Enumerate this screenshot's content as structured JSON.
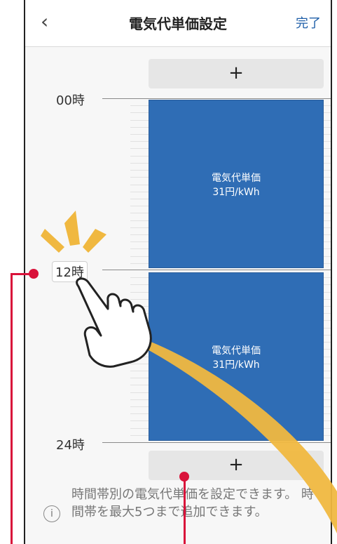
{
  "nav": {
    "back_icon": "chevron-left-icon",
    "title": "電気代単価設定",
    "done_label": "完了"
  },
  "timeline": {
    "add_label": "+",
    "hours": [
      "00時",
      "12時",
      "24時"
    ],
    "blocks": [
      {
        "label_title": "電気代単価",
        "label_price": "31円/kWh"
      },
      {
        "label_title": "電気代単価",
        "label_price": "31円/kWh"
      }
    ]
  },
  "info": {
    "icon": "info-icon",
    "text": "時間帯別の電気代単価を設定できます。 時間帯を最大5つまで追加できます。"
  },
  "colors": {
    "accent_blue": "#2f6db5",
    "callout_red": "#d9123a",
    "highlight_gold": "#f0b840"
  }
}
